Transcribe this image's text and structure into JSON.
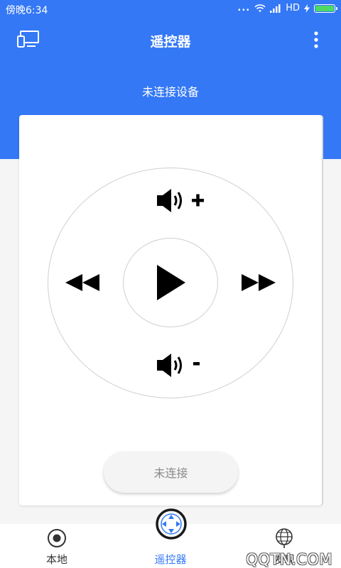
{
  "status_bar": {
    "time": "傍晚6:34",
    "dots": "...",
    "network": "HD",
    "battery_color": "#4cd964"
  },
  "header": {
    "title": "遥控器",
    "left_icon": "cast-screen-icon",
    "right_icon": "more-vert-icon"
  },
  "connection_status": "未连接设备",
  "remote": {
    "volume_up_icon": "volume-up-icon",
    "volume_down_icon": "volume-down-icon",
    "rewind_icon": "rewind-icon",
    "forward_icon": "fast-forward-icon",
    "play_icon": "play-icon"
  },
  "connect_button": {
    "label": "未连接"
  },
  "bottom_nav": {
    "items": [
      {
        "label": "本地",
        "icon": "local-record-icon",
        "active": false
      },
      {
        "label": "遥控器",
        "icon": "remote-dpad-icon",
        "active": true
      },
      {
        "label": "发现",
        "icon": "discover-globe-icon",
        "active": false
      }
    ]
  },
  "watermark": "QQTN.COM",
  "colors": {
    "primary": "#3478f6",
    "icon_dark": "#000000",
    "muted_text": "#8a8a8a"
  }
}
